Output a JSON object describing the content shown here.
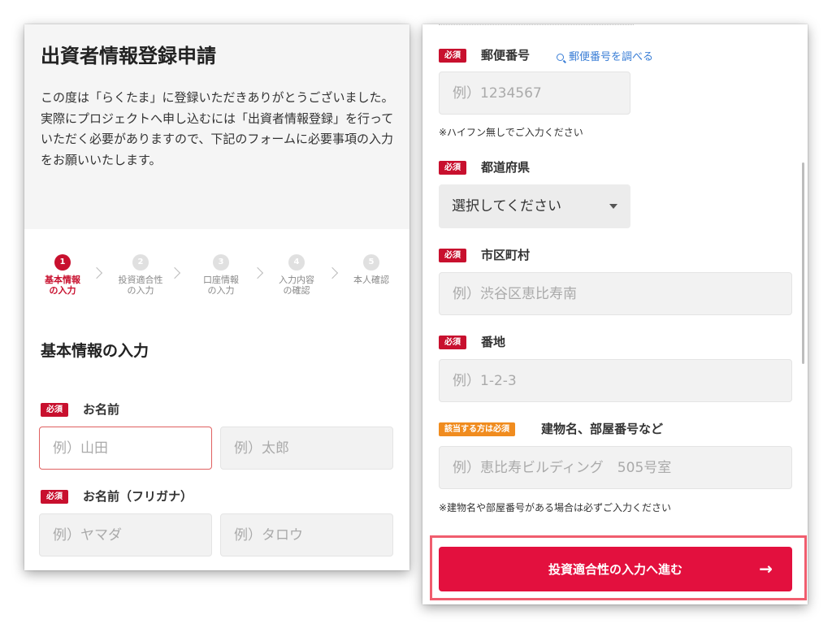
{
  "left": {
    "page_title": "出資者情報登録申請",
    "intro": "この度は「らくたま」に登録いただきありがとうございました。\n実際にプロジェクトへ申し込むには「出資者情報登録」を行っていただく必要がありますので、下記のフォームに必要事項の入力をお願いいたします。",
    "steps": [
      {
        "num": "1",
        "label": "基本情報\nの入力"
      },
      {
        "num": "2",
        "label": "投資適合性\nの入力"
      },
      {
        "num": "3",
        "label": "口座情報\nの入力"
      },
      {
        "num": "4",
        "label": "入力内容\nの確認"
      },
      {
        "num": "5",
        "label": "本人確認"
      }
    ],
    "section_title": "基本情報の入力",
    "name": {
      "badge": "必須",
      "label": "お名前",
      "last_placeholder": "例）山田",
      "first_placeholder": "例）太郎"
    },
    "kana": {
      "badge": "必須",
      "label": "お名前（フリガナ）",
      "last_placeholder": "例）ヤマダ",
      "first_placeholder": "例）タロウ"
    }
  },
  "right": {
    "postal": {
      "badge": "必須",
      "label": "郵便番号",
      "lookup_link": "郵便番号を調べる",
      "placeholder": "例）1234567",
      "note": "※ハイフン無しでご入力ください"
    },
    "prefecture": {
      "badge": "必須",
      "label": "都道府県",
      "selected": "選択してください"
    },
    "city": {
      "badge": "必須",
      "label": "市区町村",
      "placeholder": "例）渋谷区恵比寿南"
    },
    "street": {
      "badge": "必須",
      "label": "番地",
      "placeholder": "例）1-2-3"
    },
    "building": {
      "badge": "該当する方は必須",
      "label": "建物名、部屋番号など",
      "placeholder": "例）恵比寿ビルディング　505号室",
      "note": "※建物名や部屋番号がある場合は必ずご入力ください"
    },
    "next_button": "投資適合性の入力へ進む",
    "next_arrow": "→"
  },
  "colors": {
    "accent": "#c8102e",
    "button": "#e3103e",
    "optional_badge": "#f08c1f",
    "link": "#3a7ed6",
    "highlight": "#f05d6e"
  }
}
